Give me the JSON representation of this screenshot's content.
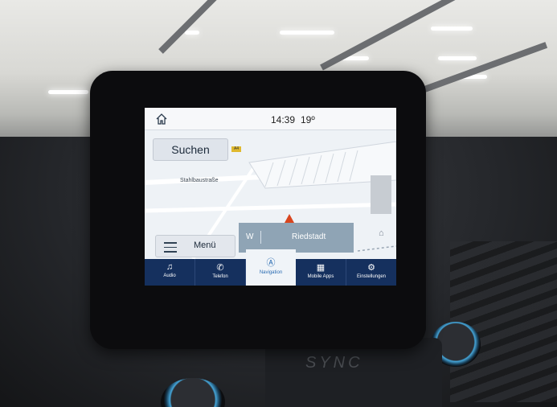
{
  "status_bar": {
    "time": "14:39",
    "temperature": "19º"
  },
  "map": {
    "search_label": "Suchen",
    "road_badge": "A4",
    "street_name": "Stahlbaustraße",
    "destination_direction": "W",
    "destination_name": "Riedstadt",
    "menu_label": "Menü"
  },
  "bottom_nav": [
    {
      "label": "Audio",
      "icon": "music-note-icon",
      "active": false
    },
    {
      "label": "Telefon",
      "icon": "phone-icon",
      "active": false
    },
    {
      "label": "Navigation",
      "icon": "navigation-icon",
      "active": true
    },
    {
      "label": "Mobile Apps",
      "icon": "apps-grid-icon",
      "active": false
    },
    {
      "label": "Einstellungen",
      "icon": "settings-icon",
      "active": false
    }
  ],
  "dash": {
    "logo_text": "SYNC"
  },
  "colors": {
    "nav_bar": "#15305e",
    "active_accent": "#2a6cb2",
    "destination_bar": "#8fa4b5"
  }
}
